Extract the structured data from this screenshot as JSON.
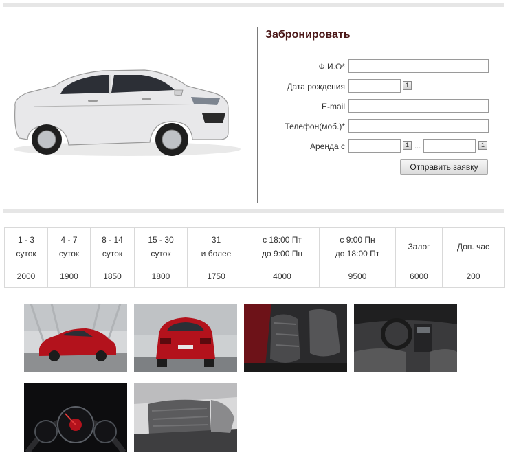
{
  "form": {
    "title": "Забронировать",
    "fields": {
      "fio": {
        "label": "Ф.И.О*",
        "value": ""
      },
      "birth": {
        "label": "Дата рождения",
        "value": "",
        "cal": "1"
      },
      "email": {
        "label": "E-mail",
        "value": ""
      },
      "phone": {
        "label": "Телефон(моб.)*",
        "value": ""
      },
      "rent": {
        "label": "Аренда с",
        "from": "",
        "to": "",
        "sep": "...",
        "cal_from": "1",
        "cal_to": "1"
      }
    },
    "submit_label": "Отправить заявку"
  },
  "prices": {
    "headers": [
      {
        "l1": "1 - 3",
        "l2": "суток"
      },
      {
        "l1": "4 - 7",
        "l2": "суток"
      },
      {
        "l1": "8 - 14",
        "l2": "суток"
      },
      {
        "l1": "15 - 30",
        "l2": "суток"
      },
      {
        "l1": "31",
        "l2": "и более"
      },
      {
        "l1": "с 18:00 Пт",
        "l2": "до 9:00 Пн"
      },
      {
        "l1": "с 9:00 Пн",
        "l2": "до 18:00 Пт"
      },
      {
        "l1": "Залог",
        "l2": ""
      },
      {
        "l1": "Доп. час",
        "l2": ""
      }
    ],
    "values": [
      "2000",
      "1900",
      "1850",
      "1800",
      "1750",
      "4000",
      "9500",
      "6000",
      "200"
    ]
  },
  "car_color": "#e8e8ea",
  "gallery_red": "#b3121c",
  "gallery": [
    "car-front-three-quarter-photo",
    "car-rear-photo",
    "front-seats-photo",
    "dashboard-photo",
    "instrument-cluster-photo",
    "rear-seats-photo"
  ]
}
